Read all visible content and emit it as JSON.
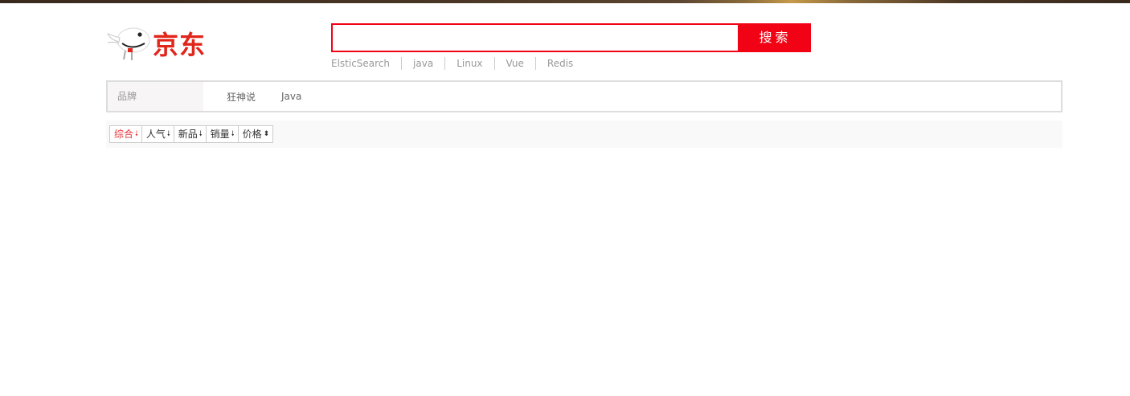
{
  "logo": {
    "text": "京东"
  },
  "search": {
    "value": "",
    "placeholder": "",
    "button_label": "搜索"
  },
  "hotwords": [
    "ElsticSearch",
    "java",
    "Linux",
    "Vue",
    "Redis"
  ],
  "filter": {
    "brand_label": "品牌",
    "brand_items": [
      "狂神说",
      "Java"
    ]
  },
  "sort": {
    "items": [
      {
        "label": "综合",
        "arrow": "🠗",
        "active": true
      },
      {
        "label": "人气",
        "arrow": "🠗",
        "active": false
      },
      {
        "label": "新品",
        "arrow": "🠗",
        "active": false
      },
      {
        "label": "销量",
        "arrow": "🠗",
        "active": false
      },
      {
        "label": "价格",
        "arrow": "⬍",
        "active": false
      }
    ]
  },
  "colors": {
    "brand_red": "#e1251b",
    "search_red": "#f10215",
    "active_sort": "#e4393c"
  }
}
